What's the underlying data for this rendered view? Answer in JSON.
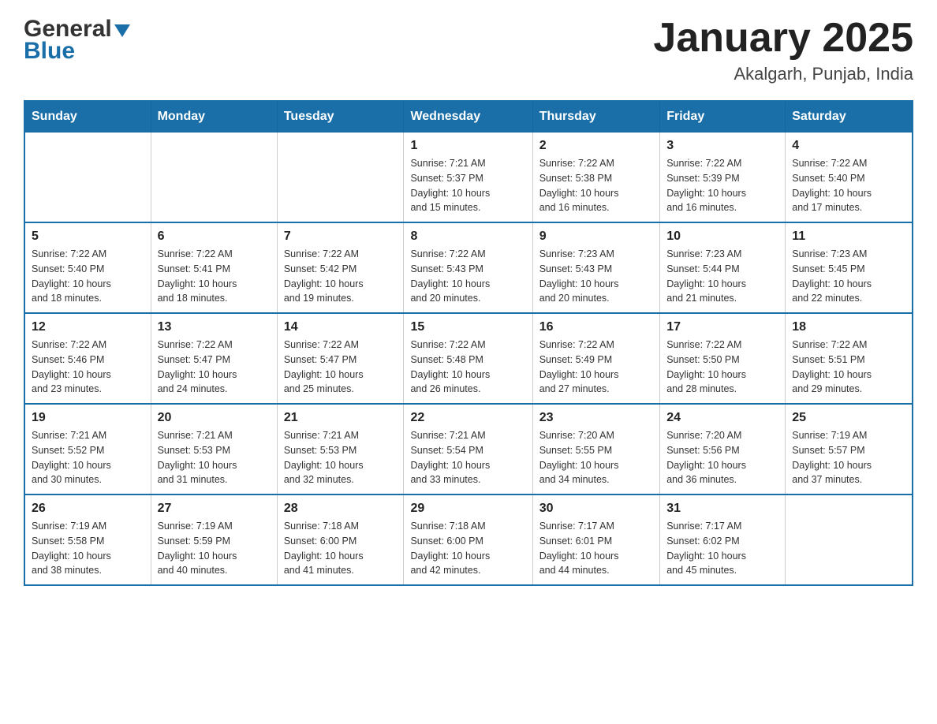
{
  "header": {
    "logo": {
      "general": "General",
      "blue": "Blue"
    },
    "title": "January 2025",
    "location": "Akalgarh, Punjab, India"
  },
  "days_of_week": [
    "Sunday",
    "Monday",
    "Tuesday",
    "Wednesday",
    "Thursday",
    "Friday",
    "Saturday"
  ],
  "weeks": [
    [
      {
        "day": "",
        "info": ""
      },
      {
        "day": "",
        "info": ""
      },
      {
        "day": "",
        "info": ""
      },
      {
        "day": "1",
        "info": "Sunrise: 7:21 AM\nSunset: 5:37 PM\nDaylight: 10 hours\nand 15 minutes."
      },
      {
        "day": "2",
        "info": "Sunrise: 7:22 AM\nSunset: 5:38 PM\nDaylight: 10 hours\nand 16 minutes."
      },
      {
        "day": "3",
        "info": "Sunrise: 7:22 AM\nSunset: 5:39 PM\nDaylight: 10 hours\nand 16 minutes."
      },
      {
        "day": "4",
        "info": "Sunrise: 7:22 AM\nSunset: 5:40 PM\nDaylight: 10 hours\nand 17 minutes."
      }
    ],
    [
      {
        "day": "5",
        "info": "Sunrise: 7:22 AM\nSunset: 5:40 PM\nDaylight: 10 hours\nand 18 minutes."
      },
      {
        "day": "6",
        "info": "Sunrise: 7:22 AM\nSunset: 5:41 PM\nDaylight: 10 hours\nand 18 minutes."
      },
      {
        "day": "7",
        "info": "Sunrise: 7:22 AM\nSunset: 5:42 PM\nDaylight: 10 hours\nand 19 minutes."
      },
      {
        "day": "8",
        "info": "Sunrise: 7:22 AM\nSunset: 5:43 PM\nDaylight: 10 hours\nand 20 minutes."
      },
      {
        "day": "9",
        "info": "Sunrise: 7:23 AM\nSunset: 5:43 PM\nDaylight: 10 hours\nand 20 minutes."
      },
      {
        "day": "10",
        "info": "Sunrise: 7:23 AM\nSunset: 5:44 PM\nDaylight: 10 hours\nand 21 minutes."
      },
      {
        "day": "11",
        "info": "Sunrise: 7:23 AM\nSunset: 5:45 PM\nDaylight: 10 hours\nand 22 minutes."
      }
    ],
    [
      {
        "day": "12",
        "info": "Sunrise: 7:22 AM\nSunset: 5:46 PM\nDaylight: 10 hours\nand 23 minutes."
      },
      {
        "day": "13",
        "info": "Sunrise: 7:22 AM\nSunset: 5:47 PM\nDaylight: 10 hours\nand 24 minutes."
      },
      {
        "day": "14",
        "info": "Sunrise: 7:22 AM\nSunset: 5:47 PM\nDaylight: 10 hours\nand 25 minutes."
      },
      {
        "day": "15",
        "info": "Sunrise: 7:22 AM\nSunset: 5:48 PM\nDaylight: 10 hours\nand 26 minutes."
      },
      {
        "day": "16",
        "info": "Sunrise: 7:22 AM\nSunset: 5:49 PM\nDaylight: 10 hours\nand 27 minutes."
      },
      {
        "day": "17",
        "info": "Sunrise: 7:22 AM\nSunset: 5:50 PM\nDaylight: 10 hours\nand 28 minutes."
      },
      {
        "day": "18",
        "info": "Sunrise: 7:22 AM\nSunset: 5:51 PM\nDaylight: 10 hours\nand 29 minutes."
      }
    ],
    [
      {
        "day": "19",
        "info": "Sunrise: 7:21 AM\nSunset: 5:52 PM\nDaylight: 10 hours\nand 30 minutes."
      },
      {
        "day": "20",
        "info": "Sunrise: 7:21 AM\nSunset: 5:53 PM\nDaylight: 10 hours\nand 31 minutes."
      },
      {
        "day": "21",
        "info": "Sunrise: 7:21 AM\nSunset: 5:53 PM\nDaylight: 10 hours\nand 32 minutes."
      },
      {
        "day": "22",
        "info": "Sunrise: 7:21 AM\nSunset: 5:54 PM\nDaylight: 10 hours\nand 33 minutes."
      },
      {
        "day": "23",
        "info": "Sunrise: 7:20 AM\nSunset: 5:55 PM\nDaylight: 10 hours\nand 34 minutes."
      },
      {
        "day": "24",
        "info": "Sunrise: 7:20 AM\nSunset: 5:56 PM\nDaylight: 10 hours\nand 36 minutes."
      },
      {
        "day": "25",
        "info": "Sunrise: 7:19 AM\nSunset: 5:57 PM\nDaylight: 10 hours\nand 37 minutes."
      }
    ],
    [
      {
        "day": "26",
        "info": "Sunrise: 7:19 AM\nSunset: 5:58 PM\nDaylight: 10 hours\nand 38 minutes."
      },
      {
        "day": "27",
        "info": "Sunrise: 7:19 AM\nSunset: 5:59 PM\nDaylight: 10 hours\nand 40 minutes."
      },
      {
        "day": "28",
        "info": "Sunrise: 7:18 AM\nSunset: 6:00 PM\nDaylight: 10 hours\nand 41 minutes."
      },
      {
        "day": "29",
        "info": "Sunrise: 7:18 AM\nSunset: 6:00 PM\nDaylight: 10 hours\nand 42 minutes."
      },
      {
        "day": "30",
        "info": "Sunrise: 7:17 AM\nSunset: 6:01 PM\nDaylight: 10 hours\nand 44 minutes."
      },
      {
        "day": "31",
        "info": "Sunrise: 7:17 AM\nSunset: 6:02 PM\nDaylight: 10 hours\nand 45 minutes."
      },
      {
        "day": "",
        "info": ""
      }
    ]
  ]
}
